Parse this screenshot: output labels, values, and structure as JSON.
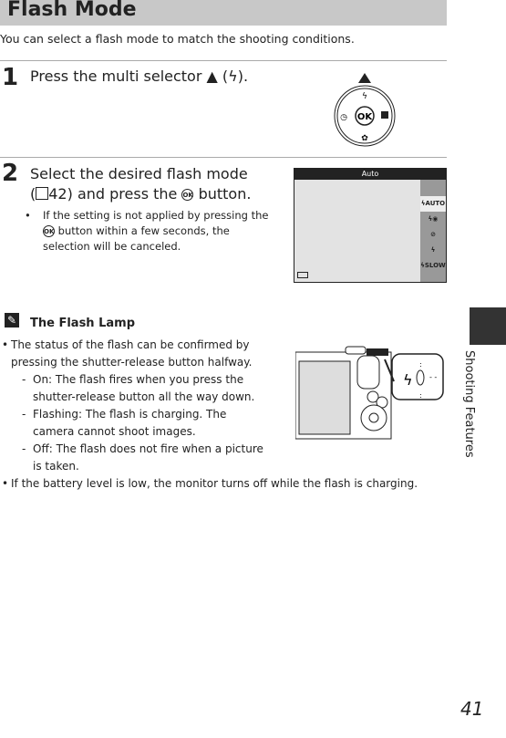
{
  "header": {
    "title": "Flash Mode"
  },
  "intro": "You can select a flash mode to match the shooting conditions.",
  "step1": {
    "number": "1",
    "text": "Press the multi selector ▲ (ϟ).",
    "dial": {
      "center": "OK"
    }
  },
  "step2": {
    "number": "2",
    "text_a": "Select the desired flash mode",
    "text_b": "(",
    "ref_icon": "book-icon",
    "ref_page": "42) and press the",
    "ok": "OK",
    "text_c": "button.",
    "bullet_a": "If the setting is not applied by pressing the",
    "bullet_b": "button within a few seconds, the selection will be canceled."
  },
  "screen": {
    "title": "Auto",
    "menu": [
      "ϟAUTO",
      "ϟ◉",
      "⊘",
      "ϟ",
      "ϟSLOW"
    ],
    "selected_index": 0
  },
  "note": {
    "title": "The Flash Lamp",
    "bullets": [
      "The status of the flash can be confirmed by pressing the shutter-release button halfway.",
      "If the battery level is low, the monitor turns off while the flash is charging."
    ],
    "subitems": [
      "On: The flash fires when you press the shutter-release button all the way down.",
      "Flashing: The flash is charging. The camera cannot shoot images.",
      "Off: The flash does not fire when a picture is taken."
    ]
  },
  "side_tab": "Shooting Features",
  "page_number": "41"
}
